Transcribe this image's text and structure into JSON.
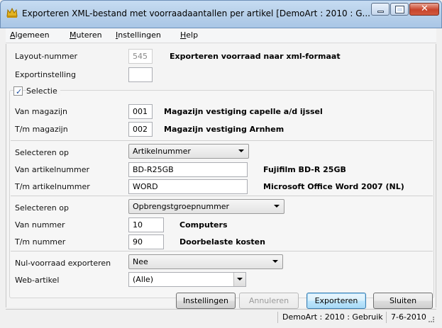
{
  "window": {
    "title": "Exporteren XML-bestand met voorraadaantallen per artikel  [DemoArt : 2010 : G..."
  },
  "menu": [
    {
      "label": "Algemeen",
      "key": "A",
      "rest": "lgemeen"
    },
    {
      "label": "Muteren",
      "key": "M",
      "rest": "uteren"
    },
    {
      "label": "Instellingen",
      "key": "I",
      "rest": "nstellingen"
    },
    {
      "label": "Help",
      "key": "H",
      "rest": "elp"
    }
  ],
  "form": {
    "layout_label": "Layout-nummer",
    "layout_value": "545",
    "layout_desc": "Exporteren voorraad naar xml-formaat",
    "export_label": "Exportinstelling",
    "export_value": "",
    "selectie_label": "Selectie",
    "selectie_checked": true,
    "van_magazijn_label": "Van magazijn",
    "van_magazijn_value": "001",
    "van_magazijn_desc": "Magazijn vestiging capelle a/d ijssel",
    "tm_magazijn_label": "T/m magazijn",
    "tm_magazijn_value": "002",
    "tm_magazijn_desc": "Magazijn vestiging Arnhem",
    "sel_op1_label": "Selecteren op",
    "sel_op1_value": "Artikelnummer",
    "van_art_label": "Van artikelnummer",
    "van_art_value": "BD-R25GB",
    "van_art_desc": "Fujifilm BD-R 25GB",
    "tm_art_label": "T/m artikelnummer",
    "tm_art_value": "WORD",
    "tm_art_desc": "Microsoft Office Word 2007 (NL)",
    "sel_op2_label": "Selecteren op",
    "sel_op2_value": "Opbrengstgroepnummer",
    "van_nr_label": "Van nummer",
    "van_nr_value": "10",
    "van_nr_desc": "Computers",
    "tm_nr_label": "T/m nummer",
    "tm_nr_value": "90",
    "tm_nr_desc": "Doorbelaste kosten",
    "nul_label": "Nul-voorraad exporteren",
    "nul_value": "Nee",
    "web_label": "Web-artikel",
    "web_value": "(Alle)"
  },
  "buttons": {
    "instellingen": "Instellingen",
    "annuleren": "Annuleren",
    "exporteren": "Exporteren",
    "sluiten": "Sluiten"
  },
  "status": {
    "context": "DemoArt : 2010 : Gebruik",
    "date": "7-6-2010"
  },
  "colors": {
    "titlebar": "#b9d1ea",
    "close_button": "#c8442b",
    "default_button": "#bee6fd"
  }
}
